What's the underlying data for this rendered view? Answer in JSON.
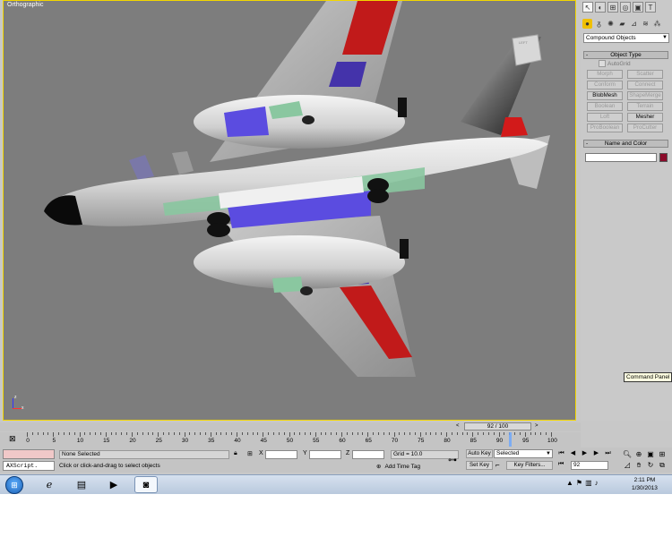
{
  "viewport": {
    "label": "Orthographic",
    "axis_x": "x",
    "axis_z": "z",
    "viewcube_label": "LEFT"
  },
  "command_panel": {
    "tabs": [
      "create-icon",
      "modify-icon",
      "hierarchy-icon",
      "motion-icon",
      "display-icon",
      "utilities-icon"
    ],
    "subtabs": [
      "geometry-icon",
      "shapes-icon",
      "lights-icon",
      "cameras-icon",
      "helpers-icon",
      "spacewarps-icon",
      "systems-icon"
    ],
    "category": "Compound Objects",
    "object_type_title": "Object Type",
    "autogrid_label": "AutoGrid",
    "buttons": [
      {
        "label": "Morph",
        "enabled": false
      },
      {
        "label": "Scatter",
        "enabled": false
      },
      {
        "label": "Conform",
        "enabled": false
      },
      {
        "label": "Connect",
        "enabled": false
      },
      {
        "label": "BlobMesh",
        "enabled": true
      },
      {
        "label": "ShapeMerge",
        "enabled": false
      },
      {
        "label": "Boolean",
        "enabled": false
      },
      {
        "label": "Terrain",
        "enabled": false
      },
      {
        "label": "Loft",
        "enabled": false
      },
      {
        "label": "Mesher",
        "enabled": true
      },
      {
        "label": "ProBoolean",
        "enabled": false
      },
      {
        "label": "ProCutter",
        "enabled": false
      }
    ],
    "name_color_title": "Name and Color",
    "name_value": "",
    "color": "#8b0a2a",
    "tooltip": "Command Panel"
  },
  "time_slider": {
    "left_arrow": "<",
    "value": "92 / 100",
    "right_arrow": ">"
  },
  "trackbar": {
    "ticks": [
      "0",
      "5",
      "10",
      "15",
      "20",
      "25",
      "30",
      "35",
      "40",
      "45",
      "50",
      "55",
      "60",
      "65",
      "70",
      "75",
      "80",
      "85",
      "90",
      "95",
      "100"
    ]
  },
  "status": {
    "maxscript": "",
    "maxscript_listener": "AXScript.",
    "selection": "None Selected",
    "prompt": "Click or click-and-drag to select objects",
    "coord_x_label": "X",
    "coord_y_label": "Y",
    "coord_z_label": "Z",
    "coord_x": "",
    "coord_y": "",
    "coord_z": "",
    "grid": "Grid = 10.0",
    "add_time_tag": "Add Time Tag",
    "auto_key": "Auto Key",
    "set_key": "Set Key",
    "selected_dropdown": "Selected",
    "key_filters": "Key Filters...",
    "current_frame": "92"
  },
  "taskbar": {
    "time": "2:11 PM",
    "date": "1/30/2013"
  }
}
